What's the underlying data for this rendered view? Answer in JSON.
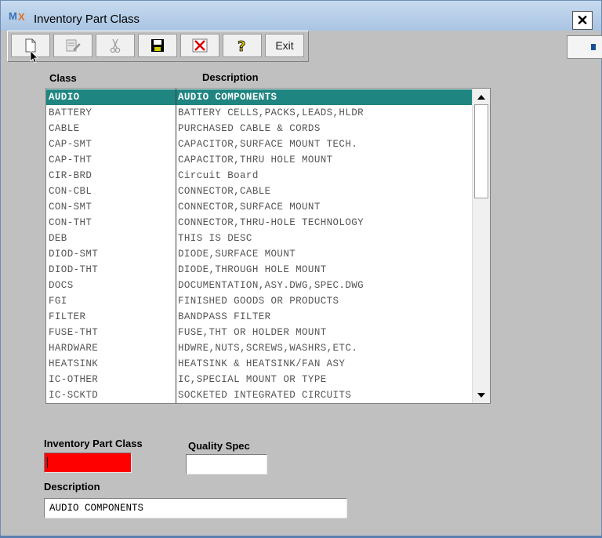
{
  "window": {
    "title": "Inventory Part Class",
    "close_glyph": "✕",
    "app_icon": "mx-logo-icon"
  },
  "toolbar": {
    "buttons": [
      {
        "name": "new",
        "icon": "new-document-icon",
        "enabled": true
      },
      {
        "name": "edit",
        "icon": "edit-icon",
        "enabled": false
      },
      {
        "name": "cut",
        "icon": "scissors-icon",
        "enabled": false
      },
      {
        "name": "save",
        "icon": "floppy-disk-icon",
        "enabled": true
      },
      {
        "name": "delete",
        "icon": "red-x-icon",
        "enabled": true
      },
      {
        "name": "help",
        "icon": "question-mark-icon",
        "enabled": true
      }
    ],
    "exit_label": "Exit"
  },
  "grid": {
    "headers": {
      "class": "Class",
      "description": "Description"
    },
    "rows": [
      {
        "class": "AUDIO",
        "description": "AUDIO COMPONENTS",
        "selected": true
      },
      {
        "class": "BATTERY",
        "description": "BATTERY CELLS,PACKS,LEADS,HLDR"
      },
      {
        "class": "CABLE",
        "description": "PURCHASED CABLE & CORDS"
      },
      {
        "class": "CAP-SMT",
        "description": "CAPACITOR,SURFACE MOUNT TECH."
      },
      {
        "class": "CAP-THT",
        "description": "CAPACITOR,THRU HOLE MOUNT"
      },
      {
        "class": "CIR-BRD",
        "description": "Circuit Board"
      },
      {
        "class": "CON-CBL",
        "description": "CONNECTOR,CABLE"
      },
      {
        "class": "CON-SMT",
        "description": "CONNECTOR,SURFACE MOUNT"
      },
      {
        "class": "CON-THT",
        "description": "CONNECTOR,THRU-HOLE TECHNOLOGY"
      },
      {
        "class": "DEB",
        "description": "THIS IS DESC"
      },
      {
        "class": "DIOD-SMT",
        "description": "DIODE,SURFACE MOUNT"
      },
      {
        "class": "DIOD-THT",
        "description": "DIODE,THROUGH HOLE MOUNT"
      },
      {
        "class": "DOCS",
        "description": "DOCUMENTATION,ASY.DWG,SPEC.DWG"
      },
      {
        "class": "FGI",
        "description": "FINISHED GOODS OR PRODUCTS"
      },
      {
        "class": "FILTER",
        "description": "BANDPASS FILTER"
      },
      {
        "class": "FUSE-THT",
        "description": "FUSE,THT OR HOLDER MOUNT"
      },
      {
        "class": "HARDWARE",
        "description": "HDWRE,NUTS,SCREWS,WASHRS,ETC."
      },
      {
        "class": "HEATSINK",
        "description": "HEATSINK & HEATSINK/FAN ASY"
      },
      {
        "class": "IC-OTHER",
        "description": "IC,SPECIAL MOUNT OR TYPE"
      },
      {
        "class": "IC-SCKTD",
        "description": "SOCKETED INTEGRATED CIRCUITS"
      }
    ]
  },
  "form": {
    "inventory_part_class_label": "Inventory Part Class",
    "inventory_part_class_value": "",
    "quality_spec_label": "Quality Spec",
    "quality_spec_value": "",
    "description_label": "Description",
    "description_value": "AUDIO COMPONENTS"
  },
  "colors": {
    "selected_row": "#1f8581",
    "required_field": "#ff0000",
    "titlebar": "#b9d1ea"
  }
}
